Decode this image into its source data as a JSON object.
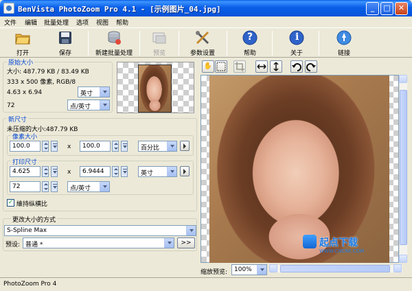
{
  "window": {
    "title": "BenVista PhotoZoom Pro 4.1 - [示例图片_04.jpg]",
    "min_label": "_",
    "max_label": "□",
    "close_label": "✕"
  },
  "menu": {
    "items": [
      "文件",
      "编辑",
      "批量处理",
      "选项",
      "视图",
      "帮助"
    ]
  },
  "toolbar": {
    "open": "打开",
    "save": "保存",
    "batch": "新建批量处理",
    "preview": "预览",
    "settings": "参数设置",
    "help": "帮助",
    "about": "关于",
    "link": "链接",
    "help_glyph": "?",
    "about_glyph": "i"
  },
  "original": {
    "section_title": "原始大小",
    "size": "大小: 487.79 KB / 83.49 KB",
    "dims": "333 x 500 像素, RGB/8",
    "print_size": "4.63 x 6.94",
    "print_unit": "英寸",
    "resolution": "72",
    "resolution_unit": "点/英寸"
  },
  "new_size": {
    "section_title": "新尺寸",
    "uncompressed": "未压缩的大小:487.79 KB",
    "pixel_group": "像素大小",
    "pixel_width": "100.0",
    "pixel_height": "100.0",
    "pixel_unit": "百分比",
    "times": "x",
    "print_group": "打印尺寸",
    "print_width": "4.625",
    "print_height": "6.9444",
    "print_unit": "英寸",
    "resolution": "72",
    "resolution_unit": "点/英寸",
    "keep_ratio": "維持纵横比",
    "keep_ratio_checked": true
  },
  "resize": {
    "section_title": "更改大小的方式",
    "method": "S-Spline Max",
    "preset_label": "预设:",
    "preset": "普通 *",
    "more_label": ">>"
  },
  "preview": {
    "zoom_label": "缩放预览:",
    "zoom_value": "100%"
  },
  "watermark": {
    "brand": "起点下载",
    "url": "WWW.CNCRK.COM"
  },
  "status": {
    "text": "PhotoZoom Pro 4"
  }
}
